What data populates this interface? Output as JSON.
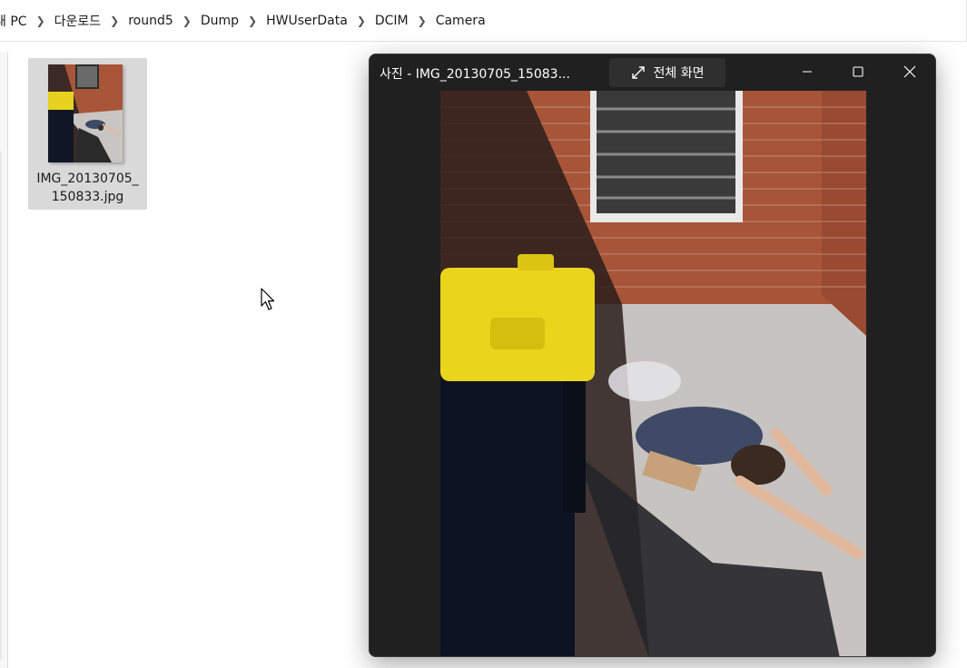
{
  "breadcrumb": {
    "items": [
      "내 PC",
      "다운로드",
      "round5",
      "Dump",
      "HWUserData",
      "DCIM",
      "Camera"
    ]
  },
  "file": {
    "name": "IMG_20130705_150833.jpg",
    "thumbnail_icon": "photo-thumbnail"
  },
  "viewer": {
    "title": "사진 - IMG_20130705_15083...",
    "fullscreen_label": "전체 화면",
    "controls": [
      "minimize-icon",
      "maximize-icon",
      "close-icon"
    ]
  },
  "colors": {
    "window_bg": "#202020",
    "titlebar_button_bg": "#2f2f2f",
    "selection": "#d9d9d9"
  }
}
